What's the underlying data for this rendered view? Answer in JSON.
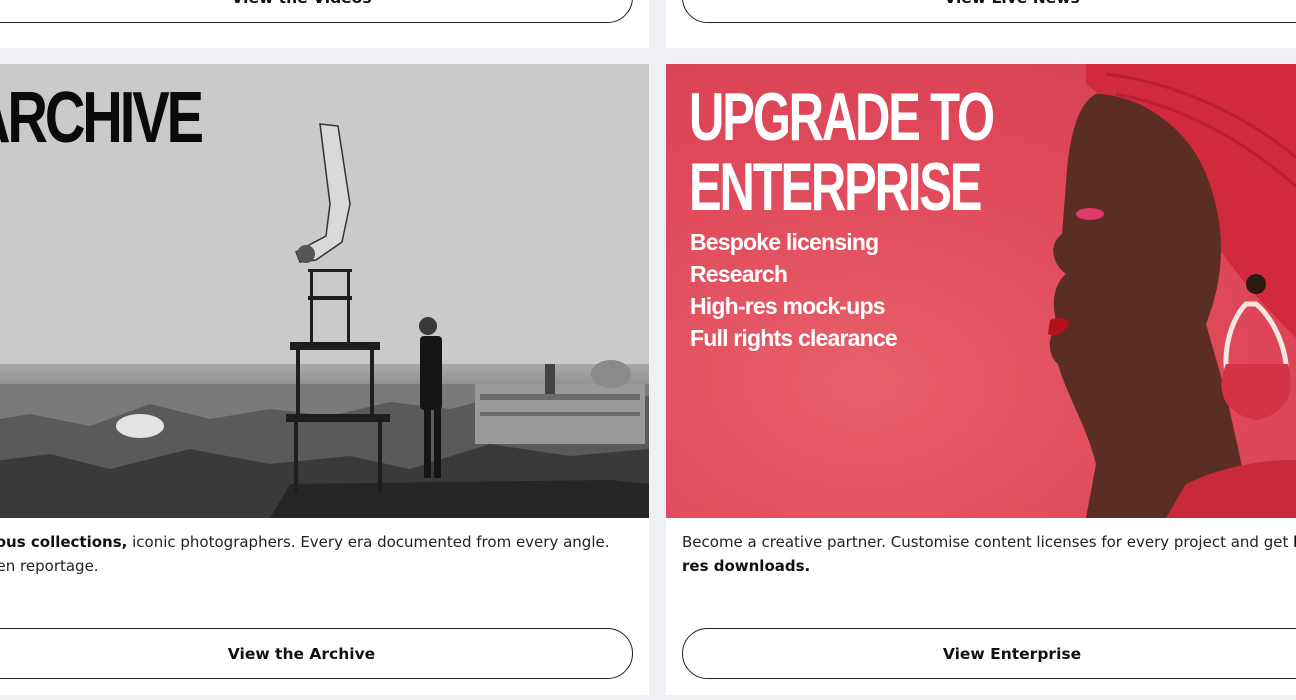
{
  "top_cards": {
    "left_button": "View the Videos",
    "right_button": "View Live News"
  },
  "archive": {
    "title": "ARCHIVE",
    "desc_bold": "amous collections,",
    "desc_line1_rest": " iconic photographers. Every era documented from every angle.",
    "desc_line2": "nseen reportage.",
    "button": "View the Archive"
  },
  "enterprise": {
    "title_line1": "UPGRADE TO",
    "title_line2": "ENTERPRISE",
    "list": [
      "Bespoke licensing",
      "Research",
      "High-res mock-ups",
      "Full rights clearance"
    ],
    "desc_line1": "Become a creative partner. Customise content licenses for every project and get ",
    "desc_bold_1": "h",
    "desc_bold_2": "res downloads.",
    "button": "View Enterprise"
  },
  "colors": {
    "enterprise_bg": "#e04c5d",
    "page_bg": "#eef0f3"
  }
}
